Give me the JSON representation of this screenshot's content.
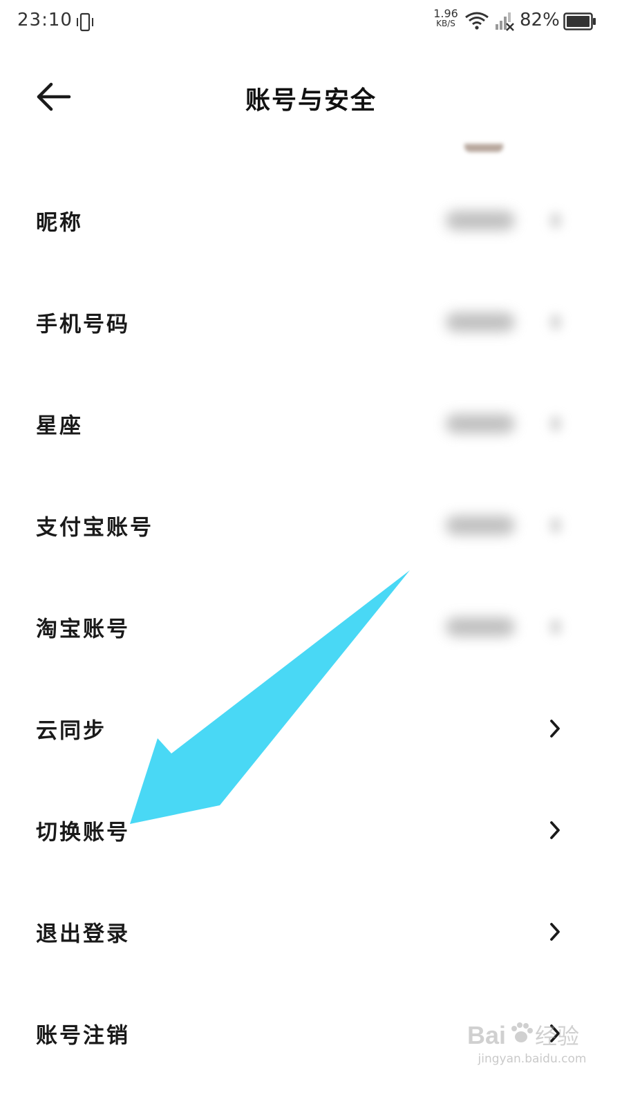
{
  "status_bar": {
    "time": "23:10",
    "net_speed_value": "1.96",
    "net_speed_unit": "KB/S",
    "battery_percent": "82%"
  },
  "header": {
    "title": "账号与安全"
  },
  "rows": [
    {
      "label": "昵称"
    },
    {
      "label": "手机号码"
    },
    {
      "label": "星座"
    },
    {
      "label": "支付宝账号"
    },
    {
      "label": "淘宝账号"
    },
    {
      "label": "云同步"
    },
    {
      "label": "切换账号"
    },
    {
      "label": "退出登录"
    },
    {
      "label": "账号注销"
    }
  ],
  "annotation": {
    "color": "#49d8f5"
  },
  "watermark": {
    "url_text": "jingyan.baidu.com"
  },
  "colors": {
    "text": "#1a1a1a",
    "background": "#ffffff",
    "arrow": "#49d8f5"
  }
}
